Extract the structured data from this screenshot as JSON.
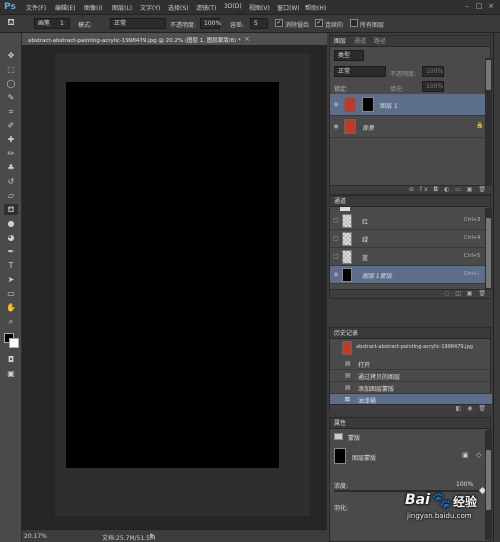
{
  "menubar": {
    "logo": "Ps",
    "items": [
      "文件(F)",
      "编辑(E)",
      "图像(I)",
      "图层(L)",
      "文字(Y)",
      "选择(S)",
      "滤镜(T)",
      "3D(D)",
      "视图(V)",
      "窗口(W)",
      "帮助(H)"
    ],
    "win_min": "–",
    "win_max": "□",
    "win_close": "×"
  },
  "options": {
    "brush_name": "画笔",
    "brush_size": "1",
    "mode_label": "模式:",
    "mode_value": "正常",
    "opacity_label": "不透明度:",
    "opacity_value": "100%",
    "flow_label": "容差:",
    "flow_value": "5",
    "antialias_label": "消除锯齿",
    "contiguous_label": "连续的",
    "all_layers_label": "所有图层"
  },
  "document": {
    "tab_title": "abstract-abstract-painting-acrylic-1998479.jpg @ 20.2% (图层 1, 图层蒙版/8) *",
    "zoom": "20.17%",
    "doc_info": "文档:25.7M/51.5M"
  },
  "layers_panel": {
    "tab1": "图层",
    "tab2": "通道",
    "tab3": "路径",
    "kind_label": "类型",
    "blend_mode": "正常",
    "opacity_label": "不透明度:",
    "opacity_value": "100%",
    "lock_label": "锁定:",
    "fill_label": "填充:",
    "fill_value": "100%",
    "layers": [
      {
        "name": "图层 1",
        "selected": true
      },
      {
        "name": "背景",
        "selected": false
      }
    ],
    "footer_icons": "⊖ fx ◘ ◐ ▭ ▣ 🗑"
  },
  "channels_panel": {
    "title": "通道",
    "channels": [
      {
        "name": "红",
        "shortcut": "Ctrl+3"
      },
      {
        "name": "绿",
        "shortcut": "Ctrl+4"
      },
      {
        "name": "蓝",
        "shortcut": "Ctrl+5"
      },
      {
        "name": "图层 1蒙版",
        "shortcut": "Ctrl+\\"
      }
    ],
    "footer_icons": "◌ ◫ ▣ 🗑"
  },
  "history_panel": {
    "title": "历史记录",
    "snapshot": "abstract-abstract-painting-acrylic-1998479.jpg",
    "steps": [
      {
        "name": "打开",
        "selected": false
      },
      {
        "name": "通过拷贝的图层",
        "selected": false
      },
      {
        "name": "添加图层蒙版",
        "selected": false
      },
      {
        "name": "油漆桶",
        "selected": true
      }
    ],
    "footer_icons": "◧ ◉ 🗑"
  },
  "properties_panel": {
    "title": "属性",
    "mask_type": "蒙版",
    "layer_mask_label": "图层蒙版",
    "density_label": "浓度:",
    "density_value": "100%",
    "feather_label": "羽化:"
  },
  "watermark": {
    "brand": "Bai",
    "brand2": "经验",
    "url": "jingyan.baidu.com"
  }
}
